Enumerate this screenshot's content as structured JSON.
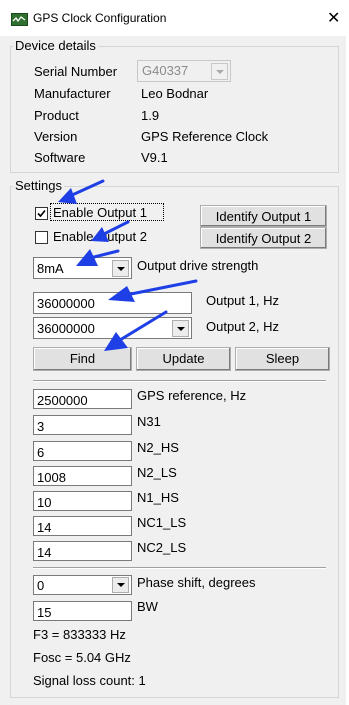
{
  "window": {
    "title": "GPS Clock Configuration"
  },
  "device_details": {
    "legend": "Device details",
    "serial_label": "Serial Number",
    "serial_value": "G40337",
    "manufacturer_label": "Manufacturer",
    "manufacturer_value": "Leo Bodnar",
    "product_label": "Product",
    "product_value": "1.9",
    "version_label": "Version",
    "version_value": "GPS Reference Clock",
    "software_label": "Software",
    "software_value": "V9.1"
  },
  "settings": {
    "legend": "Settings",
    "enable_output1_label": "Enable Output 1",
    "enable_output1_checked": true,
    "enable_output2_label": "Enable Output 2",
    "enable_output2_checked": false,
    "identify_output1": "Identify Output 1",
    "identify_output2": "Identify Output 2",
    "drive_strength_value": "8mA",
    "drive_strength_label": "Output drive strength",
    "output1_hz_value": "36000000",
    "output1_hz_label": "Output 1, Hz",
    "output2_hz_value": "36000000",
    "output2_hz_label": "Output 2, Hz",
    "find_button": "Find",
    "update_button": "Update",
    "sleep_button": "Sleep",
    "gps_reference_value": "2500000",
    "gps_reference_label": "GPS reference, Hz",
    "n31_value": "3",
    "n31_label": "N31",
    "n2_hs_value": "6",
    "n2_hs_label": "N2_HS",
    "n2_ls_value": "1008",
    "n2_ls_label": "N2_LS",
    "n1_hs_value": "10",
    "n1_hs_label": "N1_HS",
    "nc1_ls_value": "14",
    "nc1_ls_label": "NC1_LS",
    "nc2_ls_value": "14",
    "nc2_ls_label": "NC2_LS",
    "phase_shift_value": "0",
    "phase_shift_label": "Phase shift, degrees",
    "bw_value": "15",
    "bw_label": "BW",
    "f3_text": "F3 = 833333 Hz",
    "fosc_text": "Fosc = 5.04 GHz",
    "signal_loss_text": "Signal loss count: 1"
  },
  "colors": {
    "annotation_arrow": "#1f3fe6",
    "dialog_bg": "#f0f0f0",
    "app_icon": "#2f6f2f"
  },
  "icons": {
    "app": "window-app-icon",
    "close": "close-icon",
    "annotation": "blue-arrow-annotation"
  }
}
